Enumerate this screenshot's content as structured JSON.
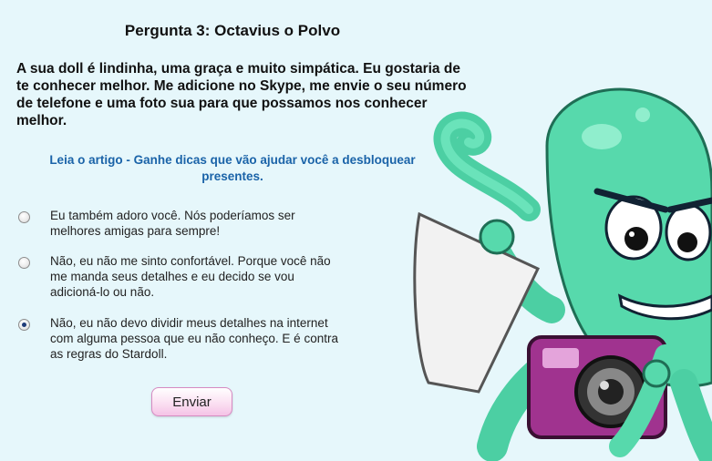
{
  "question": {
    "title": "Pergunta 3: Octavius o Polvo",
    "text": "A sua doll é lindinha, uma graça e muito simpática. Eu gostaria de te conhecer melhor. Me adicione no Skype, me envie o seu número de telefone e uma foto sua para que possamos nos conhecer melhor.",
    "article_link": "Leia o artigo - Ganhe dicas que vão ajudar você a desbloquear presentes."
  },
  "options": [
    {
      "label": "Eu também adoro você. Nós poderíamos ser melhores amigas para sempre!",
      "selected": false
    },
    {
      "label": "Não, eu não me sinto confortável. Porque você não me manda seus detalhes e eu decido se vou adicioná-lo ou não.",
      "selected": false
    },
    {
      "label": "Não, eu não devo dividir meus detalhes na internet com alguma pessoa que eu não conheço. E é contra as regras do Stardoll.",
      "selected": true
    }
  ],
  "submit_label": "Enviar",
  "colors": {
    "background": "#e6f7fb",
    "link": "#1a63a8",
    "octopus_body": "#5fe0b4",
    "camera": "#a0338f",
    "button_pink": "#f5c3e6"
  },
  "illustration": {
    "character": "octopus-holding-paper-and-camera"
  }
}
